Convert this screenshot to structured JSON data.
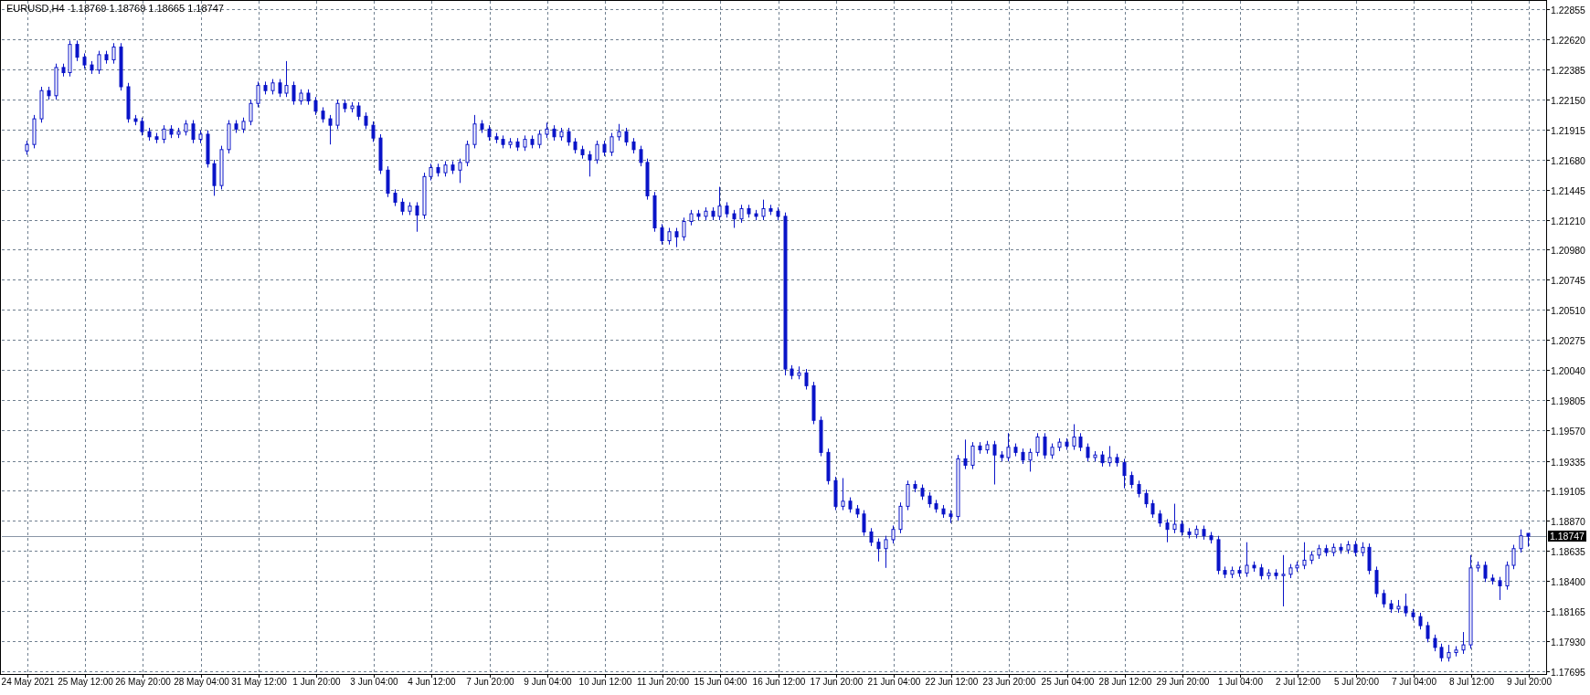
{
  "header": {
    "title": "EURUSD,H4  1.18769 1.18769 1.18665 1.18747"
  },
  "chart": {
    "chart_data": {
      "type": "candlestick",
      "yticks": [
        {
          "value": 1.22855,
          "label": "1.22855"
        },
        {
          "value": 1.2262,
          "label": "1.22620"
        },
        {
          "value": 1.22385,
          "label": "1.22385"
        },
        {
          "value": 1.2215,
          "label": "1.22150"
        },
        {
          "value": 1.21915,
          "label": "1.21915"
        },
        {
          "value": 1.2168,
          "label": "1.21680"
        },
        {
          "value": 1.21445,
          "label": "1.21445"
        },
        {
          "value": 1.2121,
          "label": "1.21210"
        },
        {
          "value": 1.2098,
          "label": "1.20980"
        },
        {
          "value": 1.20745,
          "label": "1.20745"
        },
        {
          "value": 1.2051,
          "label": "1.20510"
        },
        {
          "value": 1.20275,
          "label": "1.20275"
        },
        {
          "value": 1.2004,
          "label": "1.20040"
        },
        {
          "value": 1.19805,
          "label": "1.19805"
        },
        {
          "value": 1.1957,
          "label": "1.19570"
        },
        {
          "value": 1.19335,
          "label": "1.19335"
        },
        {
          "value": 1.19105,
          "label": "1.19105"
        },
        {
          "value": 1.1887,
          "label": "1.18870"
        },
        {
          "value": 1.18635,
          "label": "1.18635"
        },
        {
          "value": 1.184,
          "label": "1.18400"
        },
        {
          "value": 1.18165,
          "label": "1.18165"
        },
        {
          "value": 1.1793,
          "label": "1.17930"
        },
        {
          "value": 1.17695,
          "label": "1.17695"
        }
      ],
      "ylim": [
        1.17673,
        1.22919
      ],
      "grid": true,
      "ref_lines": [
        {
          "axis": "y",
          "value": 1.18747,
          "label": "1.18747"
        }
      ],
      "categories": [
        "24 May 2021",
        null,
        null,
        null,
        null,
        null,
        null,
        null,
        "25 May 12:00",
        null,
        null,
        null,
        null,
        null,
        null,
        null,
        "26 May 20:00",
        null,
        null,
        null,
        null,
        null,
        null,
        null,
        "28 May 04:00",
        null,
        null,
        null,
        null,
        null,
        null,
        null,
        "31 May 12:00",
        null,
        null,
        null,
        null,
        null,
        null,
        null,
        "1 Jun 20:00",
        null,
        null,
        null,
        null,
        null,
        null,
        null,
        "3 Jun 04:00",
        null,
        null,
        null,
        null,
        null,
        null,
        null,
        "4 Jun 12:00",
        null,
        null,
        null,
        null,
        null,
        null,
        null,
        "7 Jun 20:00",
        null,
        null,
        null,
        null,
        null,
        null,
        null,
        "9 Jun 04:00",
        null,
        null,
        null,
        null,
        null,
        null,
        null,
        "10 Jun 12:00",
        null,
        null,
        null,
        null,
        null,
        null,
        null,
        "11 Jun 20:00",
        null,
        null,
        null,
        null,
        null,
        null,
        null,
        "15 Jun 04:00",
        null,
        null,
        null,
        null,
        null,
        null,
        null,
        "16 Jun 12:00",
        null,
        null,
        null,
        null,
        null,
        null,
        null,
        "17 Jun 20:00",
        null,
        null,
        null,
        null,
        null,
        null,
        null,
        "21 Jun 04:00",
        null,
        null,
        null,
        null,
        null,
        null,
        null,
        "22 Jun 12:00",
        null,
        null,
        null,
        null,
        null,
        null,
        null,
        "23 Jun 20:00",
        null,
        null,
        null,
        null,
        null,
        null,
        null,
        "25 Jun 04:00",
        null,
        null,
        null,
        null,
        null,
        null,
        null,
        "28 Jun 12:00",
        null,
        null,
        null,
        null,
        null,
        null,
        null,
        "29 Jun 20:00",
        null,
        null,
        null,
        null,
        null,
        null,
        null,
        "1 Jul 04:00",
        null,
        null,
        null,
        null,
        null,
        null,
        null,
        "2 Jul 12:00",
        null,
        null,
        null,
        null,
        null,
        null,
        null,
        "5 Jul 20:00",
        null,
        null,
        null,
        null,
        null,
        null,
        null,
        "7 Jul 04:00",
        null,
        null,
        null,
        null,
        null,
        null,
        null,
        "8 Jul 12:00",
        null,
        null,
        null,
        null,
        null,
        null,
        null,
        "9 Jul 20:00"
      ],
      "ohlc": [
        [
          1.2175,
          1.2183,
          1.2172,
          1.218
        ],
        [
          1.218,
          1.2203,
          1.2177,
          1.22
        ],
        [
          1.22,
          1.2225,
          1.2197,
          1.2222
        ],
        [
          1.2222,
          1.2225,
          1.2215,
          1.2218
        ],
        [
          1.2218,
          1.2243,
          1.2215,
          1.224
        ],
        [
          1.224,
          1.2243,
          1.2233,
          1.2236
        ],
        [
          1.2236,
          1.2261,
          1.2233,
          1.2258
        ],
        [
          1.2258,
          1.2261,
          1.2245,
          1.2248
        ],
        [
          1.2248,
          1.2251,
          1.2239,
          1.2242
        ],
        [
          1.2242,
          1.2245,
          1.2235,
          1.2238
        ],
        [
          1.2238,
          1.2253,
          1.2235,
          1.225
        ],
        [
          1.225,
          1.2253,
          1.2243,
          1.2246
        ],
        [
          1.2246,
          1.2259,
          1.2243,
          1.2256
        ],
        [
          1.2256,
          1.2259,
          1.2222,
          1.2225
        ],
        [
          1.2225,
          1.2228,
          1.2197,
          1.22
        ],
        [
          1.22,
          1.2203,
          1.2195,
          1.2198
        ],
        [
          1.2198,
          1.2201,
          1.2187,
          1.219
        ],
        [
          1.219,
          1.2193,
          1.2183,
          1.2186
        ],
        [
          1.2186,
          1.2189,
          1.2181,
          1.2184
        ],
        [
          1.2184,
          1.2195,
          1.2181,
          1.2192
        ],
        [
          1.2192,
          1.2195,
          1.2185,
          1.2188
        ],
        [
          1.2188,
          1.2193,
          1.2185,
          1.219
        ],
        [
          1.219,
          1.2199,
          1.2187,
          1.2196
        ],
        [
          1.2196,
          1.2199,
          1.2181,
          1.2184
        ],
        [
          1.2184,
          1.2191,
          1.2181,
          1.2188
        ],
        [
          1.2188,
          1.2191,
          1.2162,
          1.2165
        ],
        [
          1.2165,
          1.2168,
          1.214,
          1.2148
        ],
        [
          1.2148,
          1.2179,
          1.2145,
          1.2176
        ],
        [
          1.2176,
          1.2199,
          1.2173,
          1.2196
        ],
        [
          1.2196,
          1.2199,
          1.2189,
          1.2192
        ],
        [
          1.2192,
          1.2201,
          1.2189,
          1.2198
        ],
        [
          1.2198,
          1.2215,
          1.2195,
          1.2212
        ],
        [
          1.2212,
          1.2229,
          1.2209,
          1.2226
        ],
        [
          1.2226,
          1.2229,
          1.2219,
          1.2222
        ],
        [
          1.2222,
          1.2231,
          1.2219,
          1.2228
        ],
        [
          1.2228,
          1.2231,
          1.2217,
          1.222
        ],
        [
          1.222,
          1.2245,
          1.2217,
          1.2226
        ],
        [
          1.2226,
          1.2229,
          1.2211,
          1.2214
        ],
        [
          1.2214,
          1.2223,
          1.2211,
          1.222
        ],
        [
          1.222,
          1.2223,
          1.2211,
          1.2214
        ],
        [
          1.2214,
          1.2217,
          1.2203,
          1.2206
        ],
        [
          1.2206,
          1.2209,
          1.2197,
          1.22
        ],
        [
          1.22,
          1.2203,
          1.218,
          1.2195
        ],
        [
          1.2195,
          1.2215,
          1.2192,
          1.2212
        ],
        [
          1.2212,
          1.2215,
          1.2205,
          1.2208
        ],
        [
          1.2208,
          1.2213,
          1.2205,
          1.221
        ],
        [
          1.221,
          1.2213,
          1.2199,
          1.2202
        ],
        [
          1.2202,
          1.2205,
          1.2192,
          1.2195
        ],
        [
          1.2195,
          1.2198,
          1.2182,
          1.2185
        ],
        [
          1.2185,
          1.2188,
          1.2157,
          1.216
        ],
        [
          1.216,
          1.2163,
          1.2139,
          1.2142
        ],
        [
          1.2142,
          1.2145,
          1.2132,
          1.2135
        ],
        [
          1.2135,
          1.2138,
          1.2125,
          1.2128
        ],
        [
          1.2128,
          1.2135,
          1.2125,
          1.2132
        ],
        [
          1.2132,
          1.2135,
          1.2112,
          1.2125
        ],
        [
          1.2125,
          1.2158,
          1.2122,
          1.2155
        ],
        [
          1.2155,
          1.2165,
          1.2152,
          1.2162
        ],
        [
          1.2162,
          1.2165,
          1.2155,
          1.2158
        ],
        [
          1.2158,
          1.2167,
          1.2155,
          1.2164
        ],
        [
          1.2164,
          1.2167,
          1.2157,
          1.216
        ],
        [
          1.216,
          1.2169,
          1.215,
          1.2166
        ],
        [
          1.2166,
          1.2183,
          1.2163,
          1.218
        ],
        [
          1.218,
          1.2203,
          1.2177,
          1.2196
        ],
        [
          1.2196,
          1.2199,
          1.2189,
          1.2192
        ],
        [
          1.2192,
          1.2195,
          1.2183,
          1.2186
        ],
        [
          1.2186,
          1.2189,
          1.2181,
          1.2184
        ],
        [
          1.2184,
          1.2187,
          1.2177,
          1.218
        ],
        [
          1.218,
          1.2185,
          1.2177,
          1.2182
        ],
        [
          1.2182,
          1.2185,
          1.2175,
          1.2178
        ],
        [
          1.2178,
          1.2187,
          1.2175,
          1.2184
        ],
        [
          1.2184,
          1.2187,
          1.2177,
          1.218
        ],
        [
          1.218,
          1.2191,
          1.2177,
          1.2188
        ],
        [
          1.2188,
          1.2197,
          1.2185,
          1.2192
        ],
        [
          1.2192,
          1.2195,
          1.2183,
          1.2186
        ],
        [
          1.2186,
          1.2193,
          1.2183,
          1.219
        ],
        [
          1.219,
          1.2193,
          1.2179,
          1.2182
        ],
        [
          1.2182,
          1.2185,
          1.2173,
          1.2176
        ],
        [
          1.2176,
          1.2179,
          1.2169,
          1.2172
        ],
        [
          1.2172,
          1.2175,
          1.2155,
          1.2168
        ],
        [
          1.2168,
          1.2183,
          1.2165,
          1.218
        ],
        [
          1.218,
          1.2183,
          1.2171,
          1.2174
        ],
        [
          1.2174,
          1.2189,
          1.2171,
          1.2186
        ],
        [
          1.2186,
          1.2196,
          1.2183,
          1.219
        ],
        [
          1.219,
          1.2193,
          1.2179,
          1.2182
        ],
        [
          1.2182,
          1.2185,
          1.2173,
          1.2176
        ],
        [
          1.2176,
          1.2179,
          1.2163,
          1.2166
        ],
        [
          1.2166,
          1.2169,
          1.2137,
          1.214
        ],
        [
          1.214,
          1.2143,
          1.2112,
          1.2115
        ],
        [
          1.2115,
          1.2118,
          1.2102,
          1.2105
        ],
        [
          1.2105,
          1.2115,
          1.2102,
          1.2112
        ],
        [
          1.2112,
          1.2115,
          1.21,
          1.2108
        ],
        [
          1.2108,
          1.2123,
          1.2105,
          1.212
        ],
        [
          1.212,
          1.2129,
          1.2117,
          1.2126
        ],
        [
          1.2126,
          1.2129,
          1.2121,
          1.2124
        ],
        [
          1.2124,
          1.2131,
          1.2121,
          1.2128
        ],
        [
          1.2128,
          1.2131,
          1.2121,
          1.2124
        ],
        [
          1.2124,
          1.2147,
          1.2121,
          1.2132
        ],
        [
          1.2132,
          1.2135,
          1.2123,
          1.2126
        ],
        [
          1.2126,
          1.2129,
          1.2115,
          1.2122
        ],
        [
          1.2122,
          1.2133,
          1.2119,
          1.213
        ],
        [
          1.213,
          1.2133,
          1.2123,
          1.2126
        ],
        [
          1.2126,
          1.2129,
          1.2121,
          1.2124
        ],
        [
          1.2124,
          1.2137,
          1.2121,
          1.213
        ],
        [
          1.213,
          1.2133,
          1.2125,
          1.2128
        ],
        [
          1.2128,
          1.2131,
          1.2121,
          1.2124
        ],
        [
          1.2124,
          1.2127,
          1.2,
          1.2005
        ],
        [
          1.2005,
          1.2008,
          1.1997,
          1.2
        ],
        [
          1.2,
          1.2007,
          1.1997,
          1.2002
        ],
        [
          1.2002,
          1.2005,
          1.1989,
          1.1992
        ],
        [
          1.1992,
          1.1995,
          1.1962,
          1.1965
        ],
        [
          1.1965,
          1.1968,
          1.1937,
          1.194
        ],
        [
          1.194,
          1.1943,
          1.1915,
          1.1918
        ],
        [
          1.1918,
          1.1921,
          1.1895,
          1.1898
        ],
        [
          1.1898,
          1.192,
          1.1895,
          1.1902
        ],
        [
          1.1902,
          1.1905,
          1.1893,
          1.1896
        ],
        [
          1.1896,
          1.1899,
          1.1889,
          1.1892
        ],
        [
          1.1892,
          1.1895,
          1.1875,
          1.1878
        ],
        [
          1.1878,
          1.1881,
          1.1867,
          1.187
        ],
        [
          1.187,
          1.1873,
          1.1855,
          1.1865
        ],
        [
          1.1865,
          1.1875,
          1.185,
          1.1872
        ],
        [
          1.1872,
          1.1883,
          1.1869,
          1.188
        ],
        [
          1.188,
          1.1901,
          1.1877,
          1.1898
        ],
        [
          1.1898,
          1.1918,
          1.1895,
          1.1915
        ],
        [
          1.1915,
          1.1918,
          1.1909,
          1.1912
        ],
        [
          1.1912,
          1.1915,
          1.1903,
          1.1906
        ],
        [
          1.1906,
          1.1909,
          1.1897,
          1.19
        ],
        [
          1.19,
          1.1903,
          1.1893,
          1.1896
        ],
        [
          1.1896,
          1.1899,
          1.1889,
          1.1892
        ],
        [
          1.1892,
          1.1895,
          1.1885,
          1.189
        ],
        [
          1.189,
          1.1938,
          1.1887,
          1.1935
        ],
        [
          1.1935,
          1.195,
          1.1927,
          1.193
        ],
        [
          1.193,
          1.1948,
          1.1927,
          1.1945
        ],
        [
          1.1945,
          1.1948,
          1.1939,
          1.1942
        ],
        [
          1.1942,
          1.1949,
          1.1939,
          1.1946
        ],
        [
          1.1946,
          1.1949,
          1.1915,
          1.1938
        ],
        [
          1.1938,
          1.1941,
          1.1933,
          1.1936
        ],
        [
          1.1936,
          1.1955,
          1.1933,
          1.1944
        ],
        [
          1.1944,
          1.1947,
          1.1937,
          1.194
        ],
        [
          1.194,
          1.1943,
          1.1931,
          1.1934
        ],
        [
          1.1934,
          1.1943,
          1.1925,
          1.194
        ],
        [
          1.194,
          1.1955,
          1.1937,
          1.1952
        ],
        [
          1.1952,
          1.1955,
          1.1935,
          1.1938
        ],
        [
          1.1938,
          1.1947,
          1.1935,
          1.1944
        ],
        [
          1.1944,
          1.1951,
          1.1941,
          1.1948
        ],
        [
          1.1948,
          1.1951,
          1.1942,
          1.1945
        ],
        [
          1.1945,
          1.1962,
          1.1942,
          1.1952
        ],
        [
          1.1952,
          1.1955,
          1.1941,
          1.1944
        ],
        [
          1.1944,
          1.1947,
          1.1933,
          1.1936
        ],
        [
          1.1936,
          1.1941,
          1.1933,
          1.1938
        ],
        [
          1.1938,
          1.1941,
          1.1929,
          1.1932
        ],
        [
          1.1932,
          1.1945,
          1.1929,
          1.1936
        ],
        [
          1.1936,
          1.1939,
          1.1929,
          1.1932
        ],
        [
          1.1932,
          1.1935,
          1.1912,
          1.1922
        ],
        [
          1.1922,
          1.1925,
          1.1912,
          1.1915
        ],
        [
          1.1915,
          1.1918,
          1.1905,
          1.1908
        ],
        [
          1.1908,
          1.1911,
          1.1897,
          1.19
        ],
        [
          1.19,
          1.1903,
          1.1889,
          1.1892
        ],
        [
          1.1892,
          1.1895,
          1.1882,
          1.1885
        ],
        [
          1.1885,
          1.1888,
          1.187,
          1.188
        ],
        [
          1.188,
          1.19,
          1.1877,
          1.1884
        ],
        [
          1.1884,
          1.1887,
          1.1875,
          1.1878
        ],
        [
          1.1878,
          1.1881,
          1.1873,
          1.1876
        ],
        [
          1.1876,
          1.1883,
          1.1873,
          1.188
        ],
        [
          1.188,
          1.1883,
          1.1872,
          1.1875
        ],
        [
          1.1875,
          1.1878,
          1.1869,
          1.1872
        ],
        [
          1.1872,
          1.1875,
          1.1845,
          1.1848
        ],
        [
          1.1848,
          1.1851,
          1.1842,
          1.1845
        ],
        [
          1.1845,
          1.1851,
          1.1842,
          1.1848
        ],
        [
          1.1848,
          1.1851,
          1.1843,
          1.1846
        ],
        [
          1.1846,
          1.187,
          1.1843,
          1.1852
        ],
        [
          1.1852,
          1.1855,
          1.1847,
          1.185
        ],
        [
          1.185,
          1.1853,
          1.1841,
          1.1844
        ],
        [
          1.1844,
          1.1849,
          1.1841,
          1.1846
        ],
        [
          1.1846,
          1.1849,
          1.1841,
          1.1844
        ],
        [
          1.1844,
          1.186,
          1.182,
          1.1845
        ],
        [
          1.1845,
          1.1853,
          1.1842,
          1.185
        ],
        [
          1.185,
          1.1855,
          1.1847,
          1.1852
        ],
        [
          1.1852,
          1.187,
          1.1849,
          1.1856
        ],
        [
          1.1856,
          1.1863,
          1.1853,
          1.186
        ],
        [
          1.186,
          1.1868,
          1.1857,
          1.1865
        ],
        [
          1.1865,
          1.1868,
          1.1859,
          1.1862
        ],
        [
          1.1862,
          1.1869,
          1.1859,
          1.1866
        ],
        [
          1.1866,
          1.1869,
          1.1861,
          1.1864
        ],
        [
          1.1864,
          1.1871,
          1.1861,
          1.1868
        ],
        [
          1.1868,
          1.1871,
          1.1859,
          1.1862
        ],
        [
          1.1862,
          1.187,
          1.1859,
          1.1866
        ],
        [
          1.1866,
          1.1869,
          1.1845,
          1.1848
        ],
        [
          1.1848,
          1.1851,
          1.1827,
          1.183
        ],
        [
          1.183,
          1.1833,
          1.1819,
          1.1822
        ],
        [
          1.1822,
          1.1825,
          1.1815,
          1.1818
        ],
        [
          1.1818,
          1.1825,
          1.1815,
          1.182
        ],
        [
          1.182,
          1.183,
          1.1812,
          1.1815
        ],
        [
          1.1815,
          1.1818,
          1.1809,
          1.1812
        ],
        [
          1.1812,
          1.1815,
          1.1802,
          1.1805
        ],
        [
          1.1805,
          1.1808,
          1.1792,
          1.1795
        ],
        [
          1.1795,
          1.1798,
          1.1785,
          1.1788
        ],
        [
          1.1788,
          1.1791,
          1.1777,
          1.178
        ],
        [
          1.178,
          1.179,
          1.1777,
          1.1784
        ],
        [
          1.1784,
          1.1789,
          1.1781,
          1.1786
        ],
        [
          1.1786,
          1.18,
          1.1783,
          1.179
        ],
        [
          1.179,
          1.186,
          1.1787,
          1.185
        ],
        [
          1.185,
          1.1855,
          1.1847,
          1.1852
        ],
        [
          1.1852,
          1.1855,
          1.1839,
          1.1842
        ],
        [
          1.1842,
          1.1845,
          1.1837,
          1.184
        ],
        [
          1.184,
          1.1843,
          1.1825,
          1.1836
        ],
        [
          1.1836,
          1.1855,
          1.1833,
          1.1852
        ],
        [
          1.1852,
          1.1868,
          1.1849,
          1.1865
        ],
        [
          1.1865,
          1.188,
          1.1862,
          1.1875
        ],
        [
          1.18769,
          1.18769,
          1.18665,
          1.18747
        ]
      ]
    }
  }
}
